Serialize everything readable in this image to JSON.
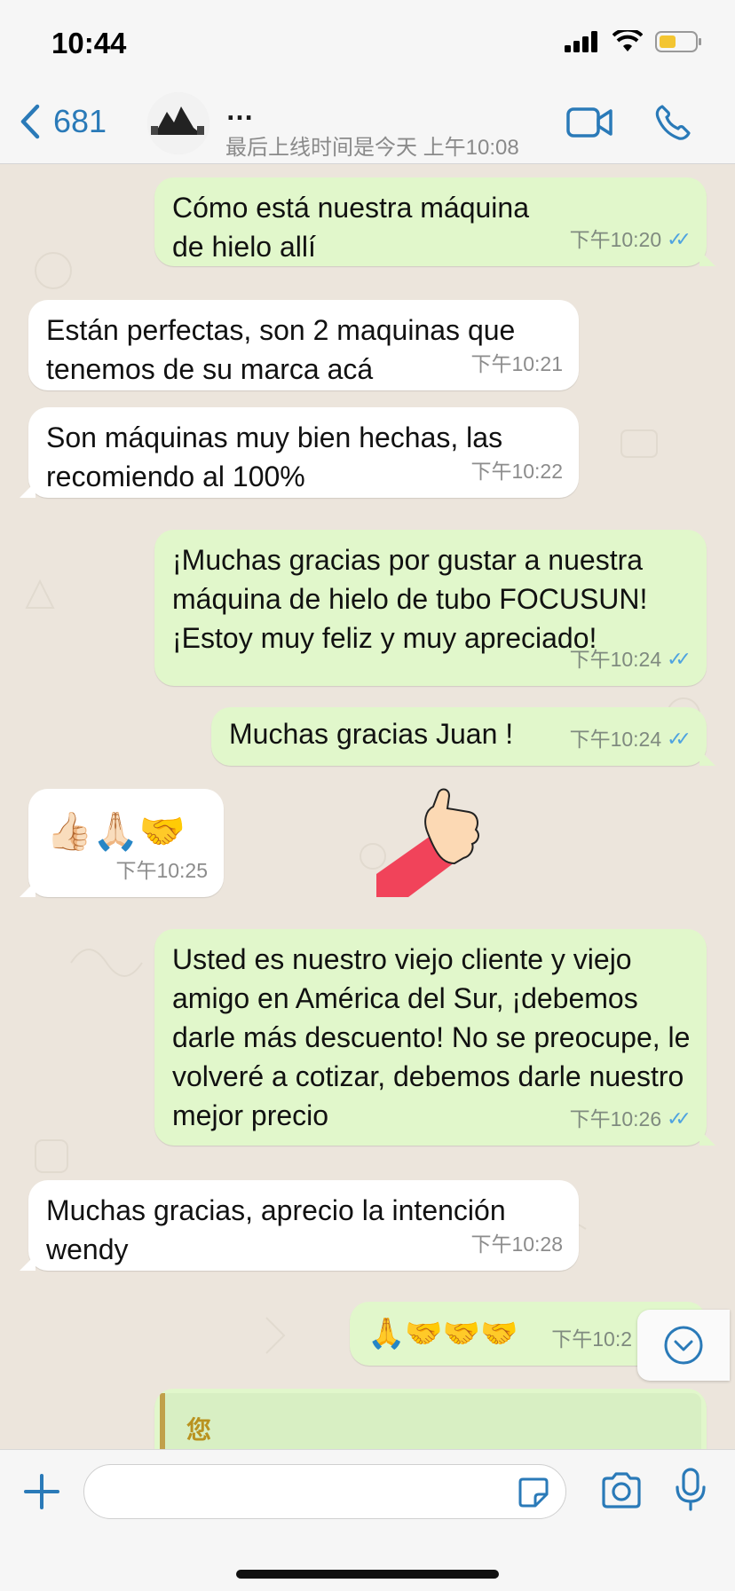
{
  "status": {
    "time": "10:44"
  },
  "header": {
    "back_count": "681",
    "title": "… ",
    "subtitle": "最后上线时间是今天 上午10:08"
  },
  "messages": [
    {
      "dir": "out",
      "text": "Cómo está nuestra máquina de hielo allí",
      "time": "下午10:20",
      "read": true
    },
    {
      "dir": "in",
      "text": "Están perfectas, son 2 maquinas que tenemos de su marca acá",
      "time": "下午10:21"
    },
    {
      "dir": "in",
      "text": "Son máquinas muy bien hechas, las recomiendo al 100%",
      "time": "下午10:22"
    },
    {
      "dir": "out",
      "text": "¡Muchas gracias por gustar a nuestra máquina de hielo de tubo FOCUSUN! ¡Estoy muy feliz y muy apreciado!",
      "time": "下午10:24",
      "read": true
    },
    {
      "dir": "out",
      "text": "Muchas gracias Juan !",
      "time": "下午10:24",
      "read": true
    },
    {
      "dir": "in",
      "text": "👍🏻🙏🏻🤝",
      "time": "下午10:25"
    },
    {
      "dir": "out",
      "text": "Usted es nuestro viejo cliente y viejo amigo en América del Sur, ¡debemos darle más descuento! No se preocupe, le volveré a cotizar, debemos darle nuestro mejor precio",
      "time": "下午10:26",
      "read": true
    },
    {
      "dir": "in",
      "text": "Muchas gracias, aprecio la intención wendy",
      "time": "下午10:28"
    },
    {
      "dir": "out",
      "text": "🙏🤝🤝🤝",
      "time": "下午10:2"
    }
  ],
  "quote": {
    "label": "您"
  },
  "composer": {
    "placeholder": ""
  },
  "colors": {
    "accent": "#2a7ab8",
    "outgoing": "#e1f7cb",
    "incoming": "#ffffff",
    "read_ticks": "#4fa3e0"
  },
  "icons": [
    "back-chevron-icon",
    "video-call-icon",
    "phone-icon",
    "plus-icon",
    "sticker-icon",
    "camera-icon",
    "mic-icon",
    "scroll-down-icon"
  ]
}
